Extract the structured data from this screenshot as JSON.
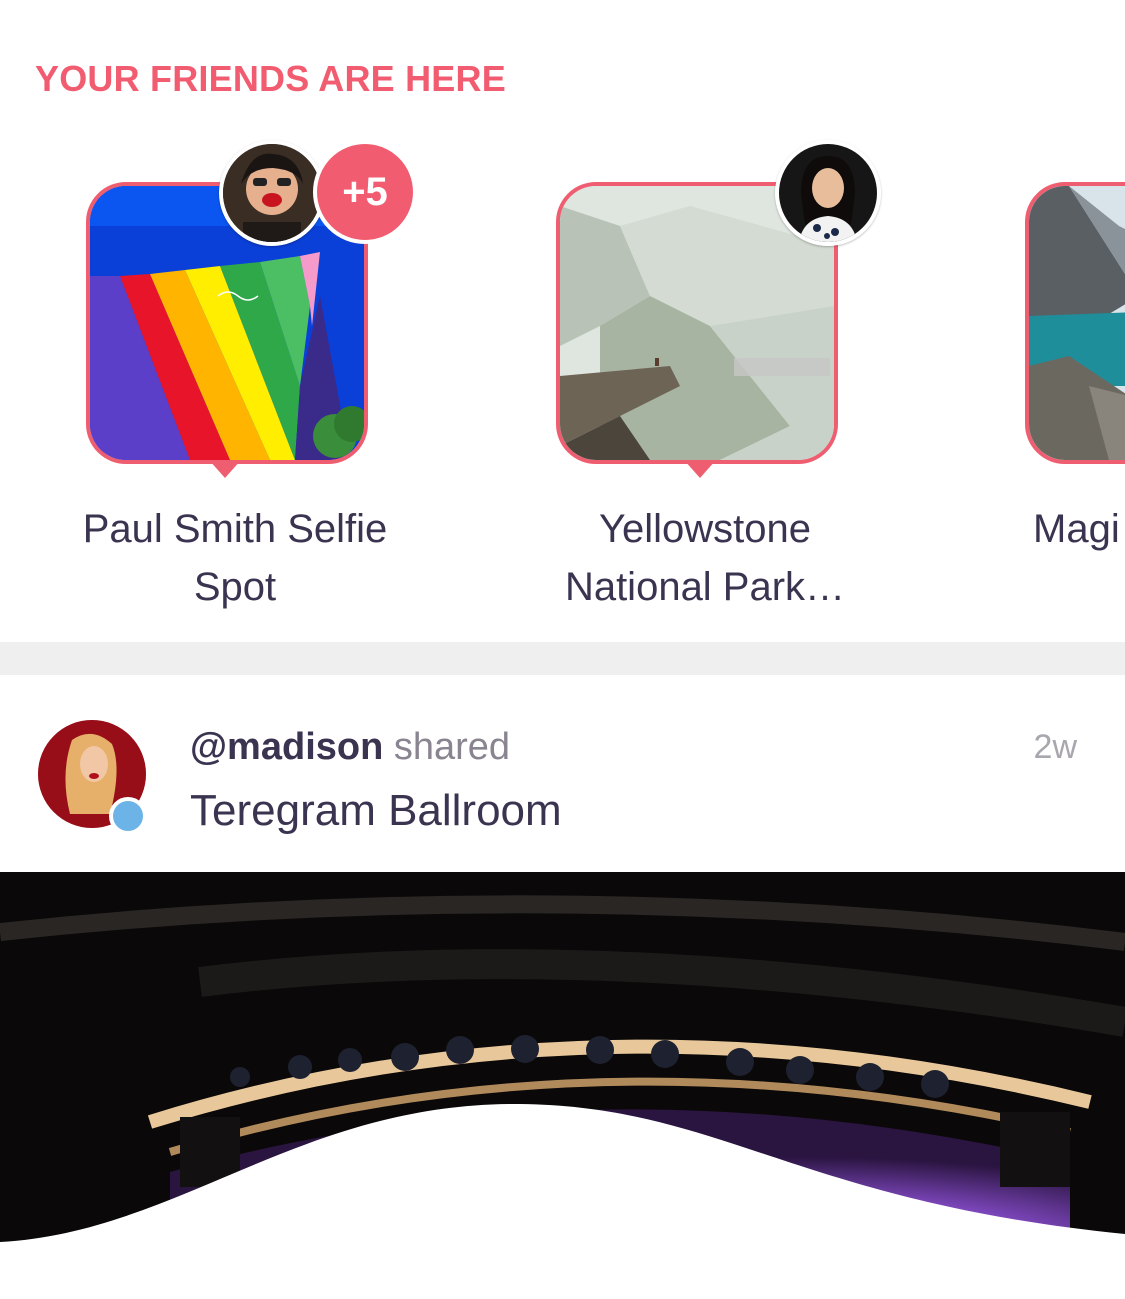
{
  "section": {
    "title": "YOUR FRIENDS ARE HERE"
  },
  "places": [
    {
      "name": "Paul Smith Selfie Spot",
      "extra_friends": "+5"
    },
    {
      "name": "Yellowstone National Park…"
    },
    {
      "name": "Magi"
    }
  ],
  "post": {
    "user": "@madison",
    "action": "shared",
    "place": "Teregram Ballroom",
    "time": "2w"
  },
  "colors": {
    "accent": "#f25c70",
    "online": "#6cb3e8",
    "divider": "#efefef"
  }
}
